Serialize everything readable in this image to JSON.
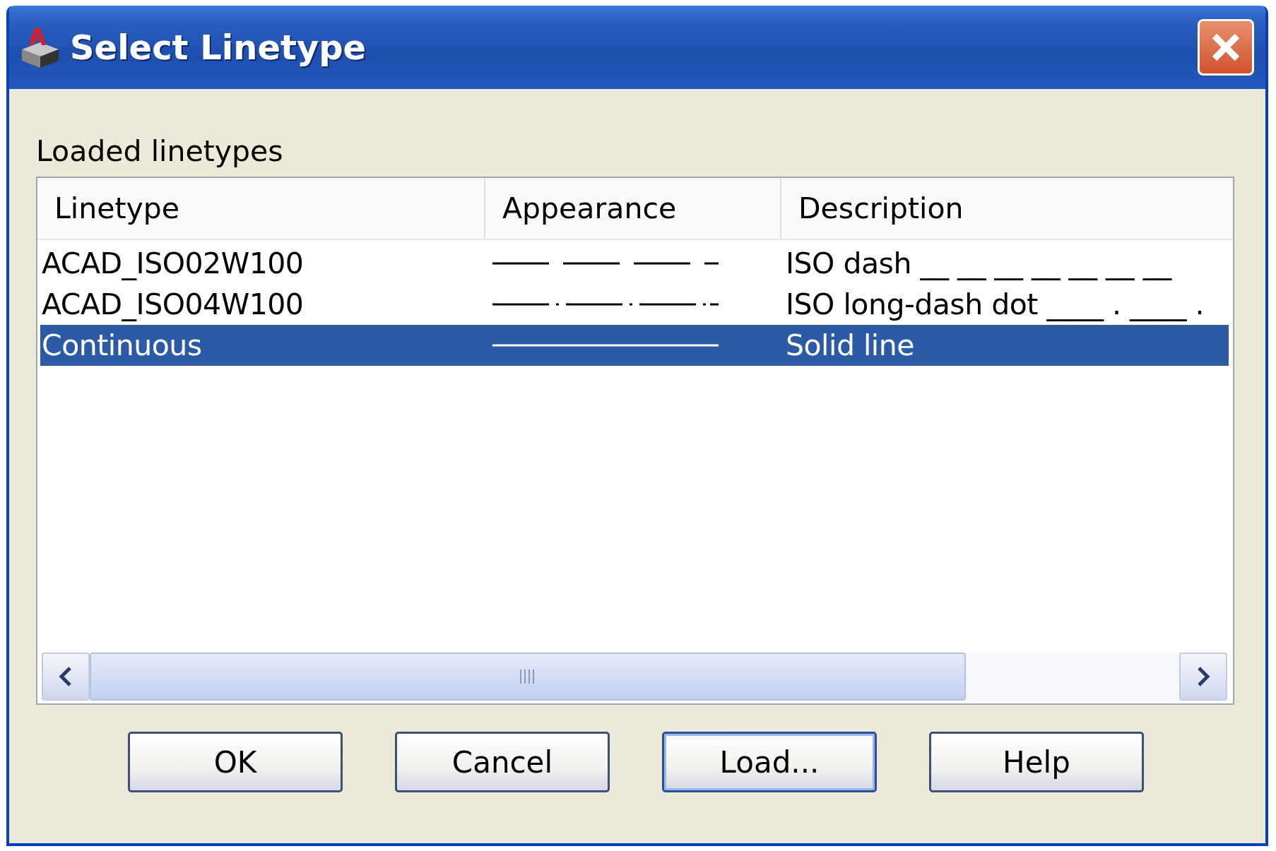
{
  "window": {
    "title": "Select Linetype"
  },
  "group_label": "Loaded linetypes",
  "table": {
    "columns": [
      "Linetype",
      "Appearance",
      "Description"
    ],
    "rows": [
      {
        "linetype": "ACAD_ISO02W100",
        "appearance": {
          "kind": "dash"
        },
        "description": "ISO dash __ __ __ __ __ __ __",
        "selected": false
      },
      {
        "linetype": "ACAD_ISO04W100",
        "appearance": {
          "kind": "dashdot"
        },
        "description": "ISO long-dash dot ____ . ____ .",
        "selected": false
      },
      {
        "linetype": "Continuous",
        "appearance": {
          "kind": "solid"
        },
        "description": "Solid line",
        "selected": true
      }
    ]
  },
  "buttons": [
    {
      "label": "OK",
      "default": false
    },
    {
      "label": "Cancel",
      "default": false
    },
    {
      "label": "Load...",
      "default": true
    },
    {
      "label": "Help",
      "default": false
    }
  ]
}
